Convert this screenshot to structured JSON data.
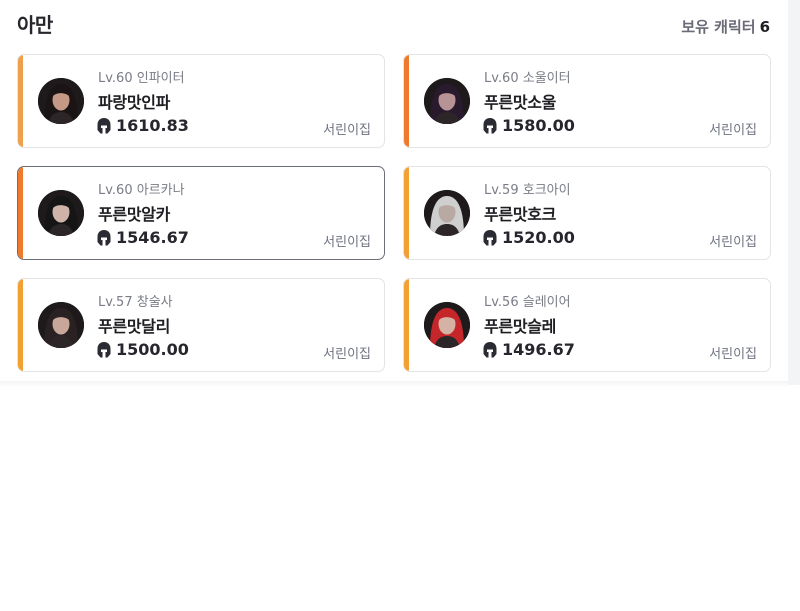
{
  "header": {
    "server": "아만",
    "owned_label": "보유 캐릭터",
    "owned_count": "6"
  },
  "characters": [
    {
      "cls": "Lv.60 인파이터",
      "name": "파랑맛인파",
      "ilvl": "1610.83",
      "guild": "서린이집",
      "accent": "#eea04a",
      "avatar_skin": "#c49a86",
      "avatar_hair": "#1b1414"
    },
    {
      "cls": "Lv.60 소울이터",
      "name": "푸른맛소울",
      "ilvl": "1580.00",
      "guild": "서린이집",
      "accent": "#ef7a2c",
      "avatar_skin": "#b79396",
      "avatar_hair": "#2a1a2e"
    },
    {
      "cls": "Lv.60 아르카나",
      "name": "푸른맛알카",
      "ilvl": "1546.67",
      "guild": "서린이집",
      "accent": "#ef7a2c",
      "avatar_skin": "#cfb2a8",
      "avatar_hair": "#151515"
    },
    {
      "cls": "Lv.59 호크아이",
      "name": "푸른맛호크",
      "ilvl": "1520.00",
      "guild": "서린이집",
      "accent": "#f2a032",
      "avatar_skin": "#b8aaa2",
      "avatar_hair": "#cfcfcf"
    },
    {
      "cls": "Lv.57 창술사",
      "name": "푸른맛달리",
      "ilvl": "1500.00",
      "guild": "서린이집",
      "accent": "#f2a032",
      "avatar_skin": "#c8a69a",
      "avatar_hair": "#2a2222"
    },
    {
      "cls": "Lv.56 슬레이어",
      "name": "푸른맛슬레",
      "ilvl": "1496.67",
      "guild": "서린이집",
      "accent": "#f2a032",
      "avatar_skin": "#d4b2a4",
      "avatar_hair": "#c4262a"
    }
  ]
}
